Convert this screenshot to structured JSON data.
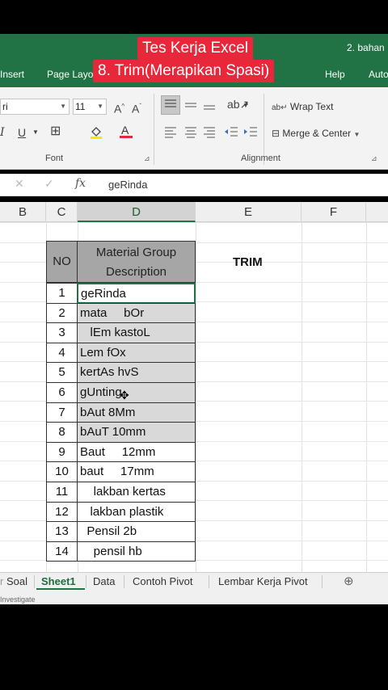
{
  "overlay": {
    "title": "Tes Kerja Excel",
    "subtitle": "8. Trim(Merapikan Spasi)"
  },
  "ribbon": {
    "tabs": [
      "Insert",
      "Page Layo",
      "Help",
      "Auto"
    ],
    "file_name": "2. bahan",
    "font_name": "ri",
    "font_size": "11",
    "wrap_text": "Wrap Text",
    "merge_center": "Merge & Center",
    "group_font": "Font",
    "group_alignment": "Alignment",
    "accent": "#217346"
  },
  "formula_bar": {
    "fx": "fx",
    "value": "geRinda"
  },
  "columns": [
    "B",
    "C",
    "D",
    "E",
    "F"
  ],
  "table": {
    "header_no": "NO",
    "header_desc_1": "Material Group",
    "header_desc_2": "Description",
    "rows": [
      {
        "no": "1",
        "desc": "geRinda"
      },
      {
        "no": "2",
        "desc": "mata     bOr"
      },
      {
        "no": "3",
        "desc": "   lEm kastoL"
      },
      {
        "no": "4",
        "desc": "Lem fOx"
      },
      {
        "no": "5",
        "desc": "kertAs hvS"
      },
      {
        "no": "6",
        "desc": "gUnting"
      },
      {
        "no": "7",
        "desc": "bAut 8Mm"
      },
      {
        "no": "8",
        "desc": "bAuT 10mm"
      },
      {
        "no": "9",
        "desc": "Baut     12mm"
      },
      {
        "no": "10",
        "desc": "baut     17mm"
      },
      {
        "no": "11",
        "desc": "    lakban kertas"
      },
      {
        "no": "12",
        "desc": "   lakban plastik"
      },
      {
        "no": "13",
        "desc": "  Pensil 2b"
      },
      {
        "no": "14",
        "desc": "    pensil hb"
      }
    ]
  },
  "e_header": "TRIM",
  "sheets": {
    "tabs": [
      "Soal",
      "Sheet1",
      "Data",
      "Contoh Pivot",
      "Lembar Kerja Pivot"
    ],
    "active": "Sheet1"
  },
  "status": "Investigate"
}
